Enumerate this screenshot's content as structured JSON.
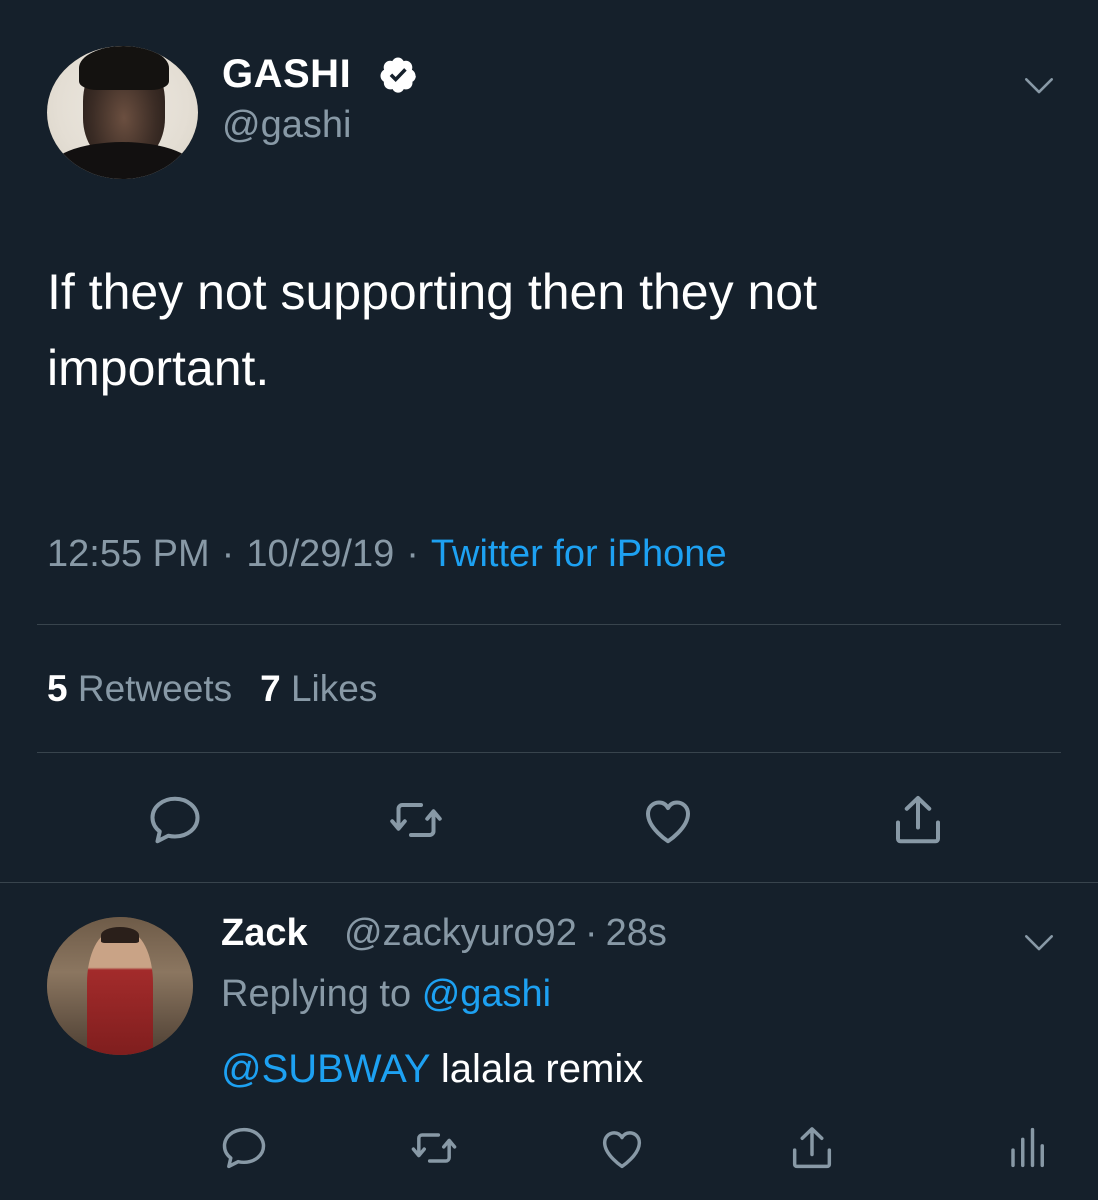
{
  "tweet": {
    "author_name": "GASHI",
    "author_handle": "@gashi",
    "text": "If they not supporting then they not important.",
    "time": "12:55 PM",
    "date": "10/29/19",
    "source": "Twitter for iPhone",
    "separator": "·",
    "retweets_count": "5",
    "retweets_label": "Retweets",
    "likes_count": "7",
    "likes_label": "Likes",
    "icons": {
      "verified": "verified-badge-icon",
      "more": "chevron-down-icon",
      "reply": "reply-bubble-icon",
      "retweet": "retweet-icon",
      "like": "heart-icon",
      "share": "share-icon"
    }
  },
  "reply": {
    "author_name": "Zack",
    "author_handle": "@zackyuro92",
    "separator": "·",
    "age": "28s",
    "replying_prefix": "Replying to",
    "replying_to": "@gashi",
    "mention": "@SUBWAY",
    "text": "lalala remix",
    "icons": {
      "more": "chevron-down-icon",
      "reply": "reply-bubble-icon",
      "retweet": "retweet-icon",
      "like": "heart-icon",
      "share": "share-icon",
      "analytics": "analytics-icon"
    }
  },
  "colors": {
    "background": "#15202b",
    "divider": "#38444d",
    "secondary_text": "#8899a6",
    "link": "#1da1f2",
    "primary_text": "#ffffff"
  }
}
